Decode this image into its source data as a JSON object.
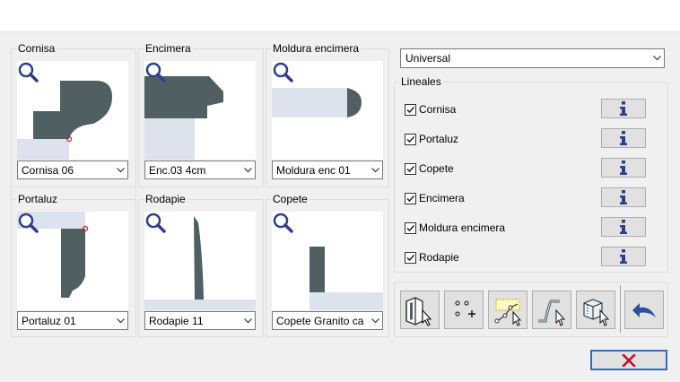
{
  "panels": {
    "cornisa": {
      "label": "Cornisa",
      "selected": "Cornisa 06"
    },
    "encimera": {
      "label": "Encimera",
      "selected": "Enc.03 4cm"
    },
    "moldura": {
      "label": "Moldura encimera",
      "selected": "Moldura enc 01"
    },
    "portaluz": {
      "label": "Portaluz",
      "selected": "Portaluz 01"
    },
    "rodapie": {
      "label": "Rodapie",
      "selected": "Rodapie 11"
    },
    "copete": {
      "label": "Copete",
      "selected": "Copete Granito ca"
    }
  },
  "mode_select": {
    "selected": "Universal"
  },
  "lineales": {
    "title": "Lineales",
    "items": [
      {
        "label": "Cornisa",
        "checked": true
      },
      {
        "label": "Portaluz",
        "checked": true
      },
      {
        "label": "Copete",
        "checked": true
      },
      {
        "label": "Encimera",
        "checked": true
      },
      {
        "label": "Moldura encimera",
        "checked": true
      },
      {
        "label": "Rodapie",
        "checked": true
      }
    ]
  },
  "icons": {
    "zoom": "magnifier-icon",
    "info": "info-icon",
    "close": "close-icon",
    "undo": "undo-arrow-icon"
  },
  "colors": {
    "profile": "#4f5f62",
    "substrate": "#dce3ee",
    "info_glyph": "#2b3f8f",
    "close_x": "#c0102a",
    "focus": "#2d6cc0"
  }
}
